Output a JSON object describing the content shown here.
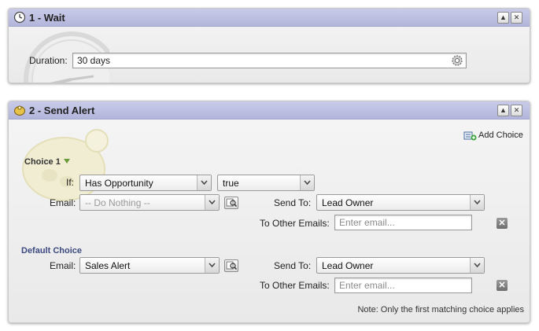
{
  "wait_step": {
    "title": "1 - Wait",
    "header_icon": "clock-icon",
    "duration_label": "Duration:",
    "duration_value": "30 days",
    "collapse_icon": "collapse-up-icon",
    "close_icon": "close-icon",
    "settings_icon": "gear-icon"
  },
  "alert_step": {
    "title": "2 - Send Alert",
    "header_icon": "alert-bell-icon",
    "add_choice_label": "Add Choice",
    "choice1": {
      "title": "Choice 1",
      "if_label": "If:",
      "condition_field": "Has Opportunity",
      "condition_value": "true",
      "email_label": "Email:",
      "email_value": "-- Do Nothing --",
      "send_to_label": "Send To:",
      "send_to_value": "Lead Owner",
      "other_emails_label": "To Other Emails:",
      "other_emails_placeholder": "Enter email..."
    },
    "default_choice": {
      "title": "Default Choice",
      "email_label": "Email:",
      "email_value": "Sales Alert",
      "send_to_label": "Send To:",
      "send_to_value": "Lead Owner",
      "other_emails_label": "To Other Emails:",
      "other_emails_placeholder": "Enter email..."
    },
    "note": "Note: Only the first matching choice applies"
  }
}
